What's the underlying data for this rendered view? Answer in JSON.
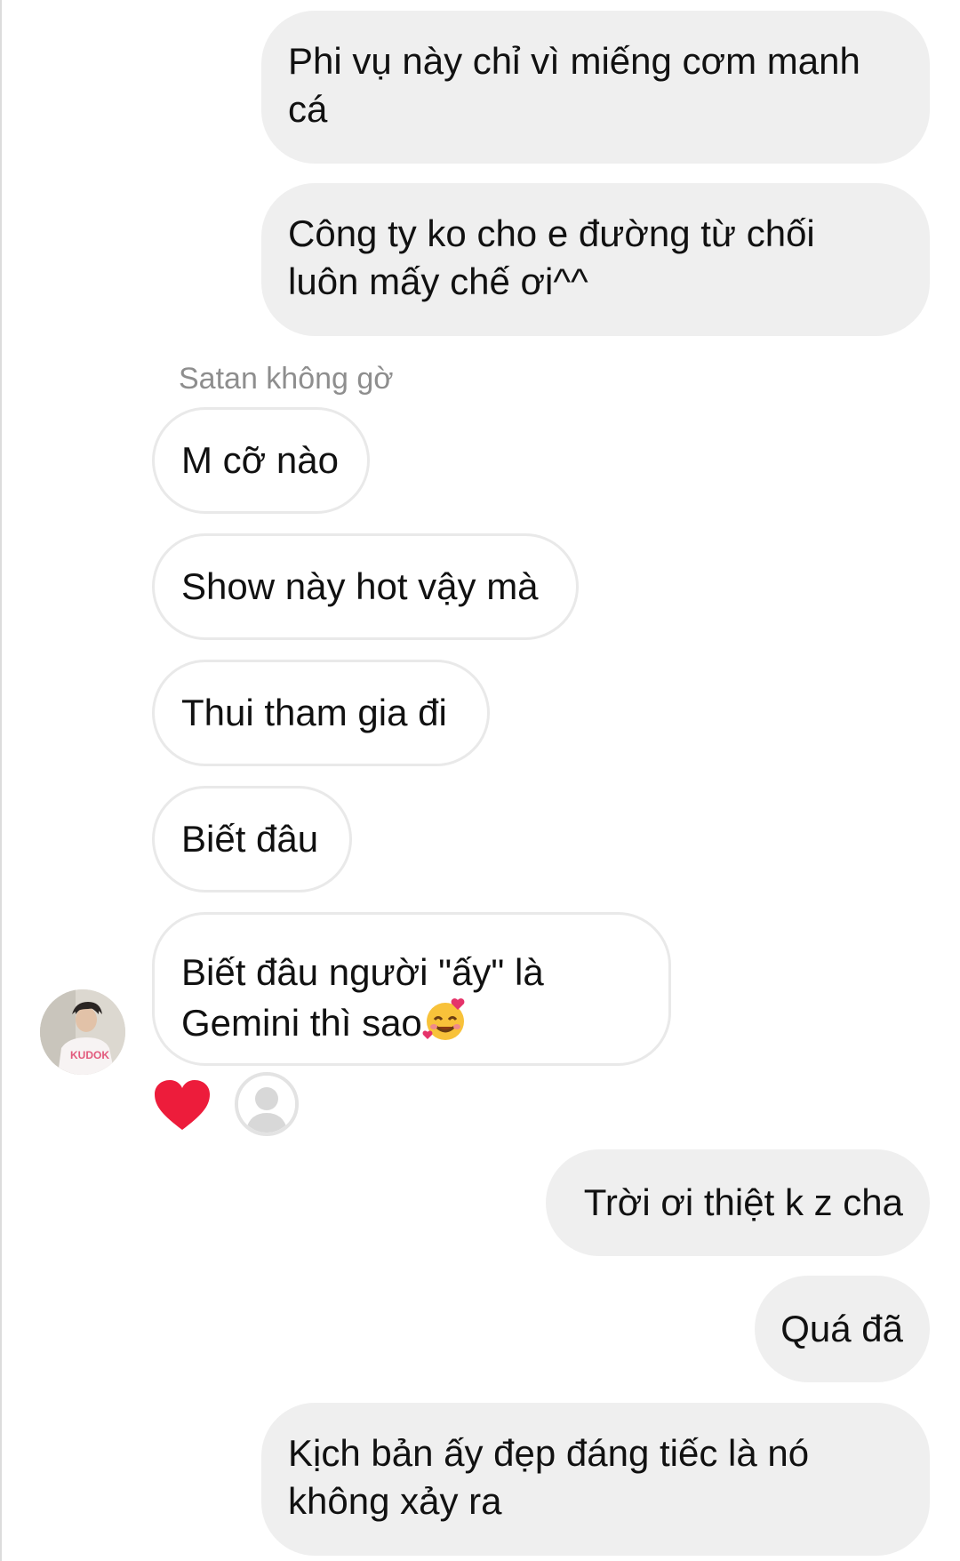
{
  "conversation": {
    "messages": [
      {
        "direction": "outgoing",
        "lines": [
          "Phi vụ này chỉ vì miếng cơm manh",
          "cá"
        ]
      },
      {
        "direction": "outgoing",
        "lines": [
          "Công ty ko cho e đường từ chối",
          "luôn mấy chế ơi^^"
        ]
      },
      {
        "direction": "incoming",
        "lines": [
          "M cỡ nào"
        ]
      },
      {
        "direction": "incoming",
        "lines": [
          "Show này hot vậy mà"
        ]
      },
      {
        "direction": "incoming",
        "lines": [
          "Thui tham gia đi"
        ]
      },
      {
        "direction": "incoming",
        "lines": [
          "Biết đâu"
        ]
      },
      {
        "direction": "incoming",
        "lines": [
          "Biết đâu người \"ấy\" là",
          "Gemini thì sao"
        ],
        "emoji": "smiling-face-with-hearts-emoji"
      },
      {
        "direction": "outgoing",
        "lines": [
          "Trời ơi thiệt k z cha"
        ]
      },
      {
        "direction": "outgoing",
        "lines": [
          "Quá đã"
        ]
      },
      {
        "direction": "outgoing",
        "lines": [
          "Kịch bản ấy đẹp đáng tiếc là nó",
          "không xảy ra"
        ]
      }
    ],
    "sender_name": "Satan không gờ",
    "reaction": {
      "icon": "heart-icon",
      "color": "#ed1c3b",
      "reactor": "default-avatar-icon"
    }
  },
  "colors": {
    "outgoing_bubble": "#efefef",
    "incoming_border": "#e9e9e9",
    "sender_name": "#8e8e8e"
  }
}
